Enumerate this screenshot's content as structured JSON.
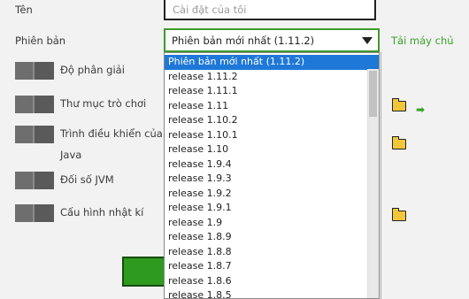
{
  "form": {
    "name_label": "Tên",
    "name_placeholder": "Cài đặt của tôi",
    "version_label": "Phiên bản",
    "version_selected": "Phiên bản mới nhất (1.11.2)",
    "download_server_link": "Tải máy chủ"
  },
  "options": [
    {
      "label": "Độ phân giải"
    },
    {
      "label": "Thư mục trò chơi"
    },
    {
      "label": "Trình điều khiển của",
      "label2": "Java"
    },
    {
      "label": "Đối số JVM"
    },
    {
      "label": "Cấu hình nhật kí"
    }
  ],
  "dropdown": {
    "items": [
      "Phiên bản mới nhất (1.11.2)",
      "release 1.11.2",
      "release 1.11.1",
      "release 1.11",
      "release 1.10.2",
      "release 1.10.1",
      "release 1.10",
      "release 1.9.4",
      "release 1.9.3",
      "release 1.9.2",
      "release 1.9.1",
      "release 1.9",
      "release 1.8.9",
      "release 1.8.8",
      "release 1.8.7",
      "release 1.8.6",
      "release 1.8.5"
    ]
  },
  "icons": {
    "folder": "folder-icon",
    "arrow": "arrow-right-icon"
  },
  "colors": {
    "accent_green": "#3aa12b",
    "selected_blue": "#1e78d7",
    "save_button": "#2e9a1f"
  }
}
